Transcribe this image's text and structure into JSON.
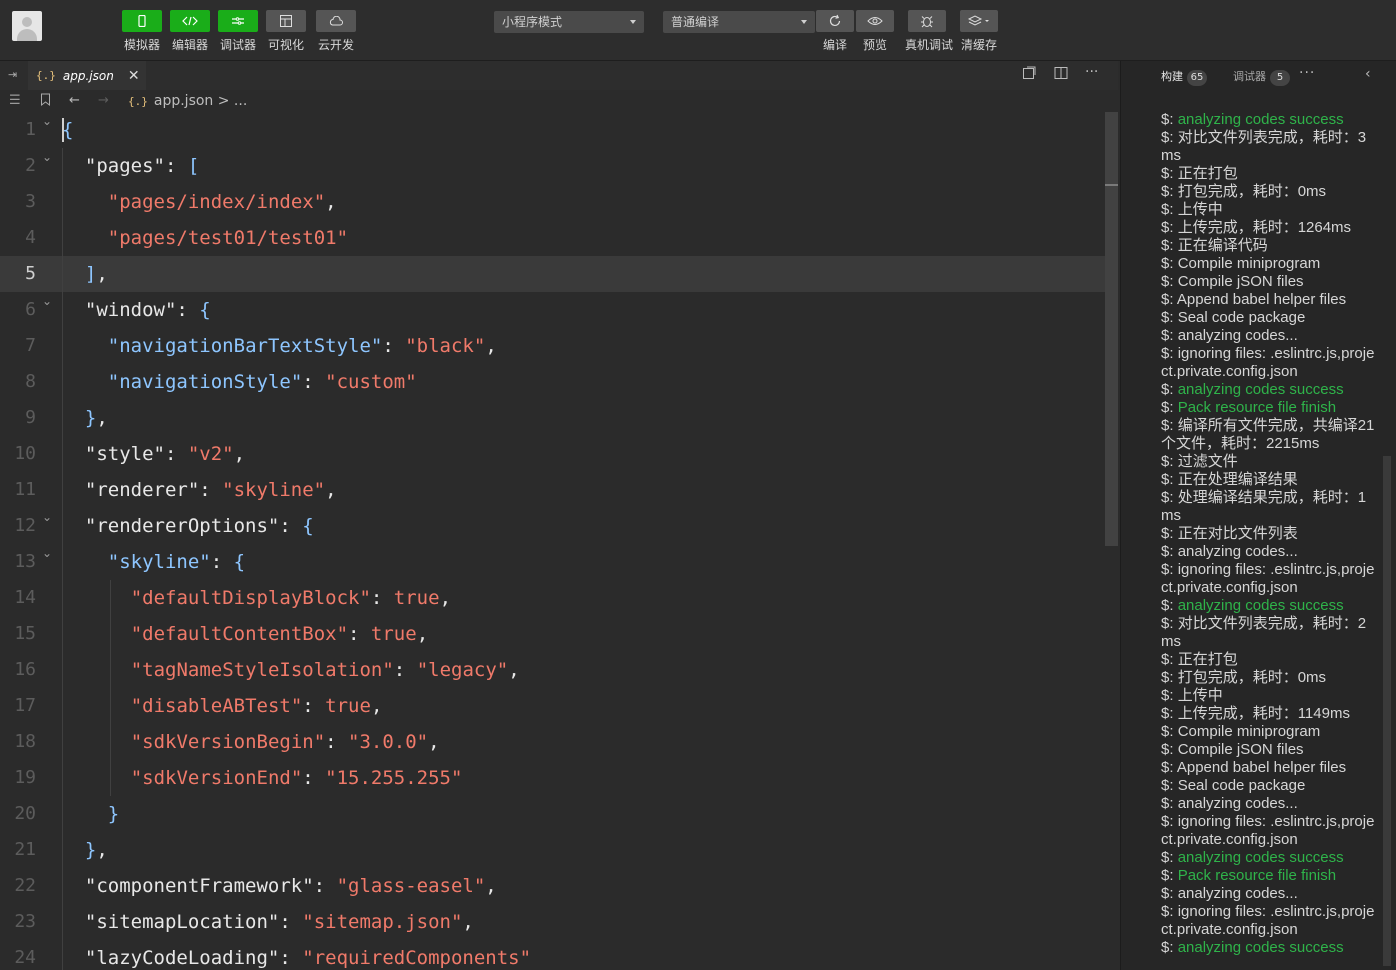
{
  "toolbar": {
    "left_buttons": [
      {
        "label": "模拟器",
        "icon": "phone-icon"
      },
      {
        "label": "编辑器",
        "icon": "code-icon"
      },
      {
        "label": "调试器",
        "icon": "debug-icon"
      },
      {
        "label": "可视化",
        "icon": "layout-icon"
      },
      {
        "label": "云开发",
        "icon": "cloud-icon"
      }
    ],
    "mode_select": "小程序模式",
    "compile_select": "普通编译",
    "right_buttons": [
      {
        "label": "编译",
        "icon": "refresh-icon"
      },
      {
        "label": "预览",
        "icon": "eye-icon"
      },
      {
        "label": "真机调试",
        "icon": "bug-icon"
      },
      {
        "label": "清缓存",
        "icon": "layers-icon"
      }
    ]
  },
  "editor": {
    "tab": {
      "name": "app.json",
      "close": "✕",
      "icon": "{.}"
    },
    "breadcrumb": "app.json > ...",
    "breadcrumb_icon": "{.}",
    "current_line": 5,
    "lines": [
      {
        "n": "1",
        "indent": 0,
        "tokens": [
          {
            "c": "p",
            "t": "{"
          }
        ]
      },
      {
        "n": "2",
        "indent": 1,
        "tokens": [
          {
            "c": "k",
            "t": "\"pages\""
          },
          {
            "c": "k",
            "t": ": "
          },
          {
            "c": "p",
            "t": "["
          }
        ]
      },
      {
        "n": "3",
        "indent": 2,
        "tokens": [
          {
            "c": "s",
            "t": "\"pages/index/index\""
          },
          {
            "c": "k",
            "t": ","
          }
        ]
      },
      {
        "n": "4",
        "indent": 2,
        "tokens": [
          {
            "c": "s",
            "t": "\"pages/test01/test01\""
          }
        ]
      },
      {
        "n": "5",
        "indent": 1,
        "tokens": [
          {
            "c": "p",
            "t": "]"
          },
          {
            "c": "k",
            "t": ","
          }
        ]
      },
      {
        "n": "6",
        "indent": 1,
        "tokens": [
          {
            "c": "k",
            "t": "\"window\""
          },
          {
            "c": "k",
            "t": ": "
          },
          {
            "c": "p",
            "t": "{"
          }
        ]
      },
      {
        "n": "7",
        "indent": 2,
        "tokens": [
          {
            "c": "p",
            "t": "\"navigationBarTextStyle\""
          },
          {
            "c": "k",
            "t": ": "
          },
          {
            "c": "s",
            "t": "\"black\""
          },
          {
            "c": "k",
            "t": ","
          }
        ]
      },
      {
        "n": "8",
        "indent": 2,
        "tokens": [
          {
            "c": "p",
            "t": "\"navigationStyle\""
          },
          {
            "c": "k",
            "t": ": "
          },
          {
            "c": "s",
            "t": "\"custom\""
          }
        ]
      },
      {
        "n": "9",
        "indent": 1,
        "tokens": [
          {
            "c": "p",
            "t": "}"
          },
          {
            "c": "k",
            "t": ","
          }
        ]
      },
      {
        "n": "10",
        "indent": 1,
        "tokens": [
          {
            "c": "k",
            "t": "\"style\""
          },
          {
            "c": "k",
            "t": ": "
          },
          {
            "c": "s",
            "t": "\"v2\""
          },
          {
            "c": "k",
            "t": ","
          }
        ]
      },
      {
        "n": "11",
        "indent": 1,
        "tokens": [
          {
            "c": "k",
            "t": "\"renderer\""
          },
          {
            "c": "k",
            "t": ": "
          },
          {
            "c": "s",
            "t": "\"skyline\""
          },
          {
            "c": "k",
            "t": ","
          }
        ]
      },
      {
        "n": "12",
        "indent": 1,
        "tokens": [
          {
            "c": "k",
            "t": "\"rendererOptions\""
          },
          {
            "c": "k",
            "t": ": "
          },
          {
            "c": "p",
            "t": "{"
          }
        ]
      },
      {
        "n": "13",
        "indent": 2,
        "tokens": [
          {
            "c": "p",
            "t": "\"skyline\""
          },
          {
            "c": "k",
            "t": ": "
          },
          {
            "c": "p",
            "t": "{"
          }
        ]
      },
      {
        "n": "14",
        "indent": 3,
        "tokens": [
          {
            "c": "s",
            "t": "\"defaultDisplayBlock\""
          },
          {
            "c": "k",
            "t": ": "
          },
          {
            "c": "t",
            "t": "true"
          },
          {
            "c": "k",
            "t": ","
          }
        ]
      },
      {
        "n": "15",
        "indent": 3,
        "tokens": [
          {
            "c": "s",
            "t": "\"defaultContentBox\""
          },
          {
            "c": "k",
            "t": ": "
          },
          {
            "c": "t",
            "t": "true"
          },
          {
            "c": "k",
            "t": ","
          }
        ]
      },
      {
        "n": "16",
        "indent": 3,
        "tokens": [
          {
            "c": "s",
            "t": "\"tagNameStyleIsolation\""
          },
          {
            "c": "k",
            "t": ": "
          },
          {
            "c": "s",
            "t": "\"legacy\""
          },
          {
            "c": "k",
            "t": ","
          }
        ]
      },
      {
        "n": "17",
        "indent": 3,
        "tokens": [
          {
            "c": "s",
            "t": "\"disableABTest\""
          },
          {
            "c": "k",
            "t": ": "
          },
          {
            "c": "t",
            "t": "true"
          },
          {
            "c": "k",
            "t": ","
          }
        ]
      },
      {
        "n": "18",
        "indent": 3,
        "tokens": [
          {
            "c": "s",
            "t": "\"sdkVersionBegin\""
          },
          {
            "c": "k",
            "t": ": "
          },
          {
            "c": "s",
            "t": "\"3.0.0\""
          },
          {
            "c": "k",
            "t": ","
          }
        ]
      },
      {
        "n": "19",
        "indent": 3,
        "tokens": [
          {
            "c": "s",
            "t": "\"sdkVersionEnd\""
          },
          {
            "c": "k",
            "t": ": "
          },
          {
            "c": "s",
            "t": "\"15.255.255\""
          }
        ]
      },
      {
        "n": "20",
        "indent": 2,
        "tokens": [
          {
            "c": "p",
            "t": "}"
          }
        ]
      },
      {
        "n": "21",
        "indent": 1,
        "tokens": [
          {
            "c": "p",
            "t": "}"
          },
          {
            "c": "k",
            "t": ","
          }
        ]
      },
      {
        "n": "22",
        "indent": 1,
        "tokens": [
          {
            "c": "k",
            "t": "\"componentFramework\""
          },
          {
            "c": "k",
            "t": ": "
          },
          {
            "c": "s",
            "t": "\"glass-easel\""
          },
          {
            "c": "k",
            "t": ","
          }
        ]
      },
      {
        "n": "23",
        "indent": 1,
        "tokens": [
          {
            "c": "k",
            "t": "\"sitemapLocation\""
          },
          {
            "c": "k",
            "t": ": "
          },
          {
            "c": "s",
            "t": "\"sitemap.json\""
          },
          {
            "c": "k",
            "t": ","
          }
        ]
      },
      {
        "n": "24",
        "indent": 1,
        "tokens": [
          {
            "c": "k",
            "t": "\"lazyCodeLoading\""
          },
          {
            "c": "k",
            "t": ": "
          },
          {
            "c": "s",
            "t": "\"requiredComponents\""
          }
        ]
      }
    ]
  },
  "panel": {
    "tabs": [
      {
        "label": "构建",
        "count": "65"
      },
      {
        "label": "调试器",
        "count": "5"
      }
    ],
    "more": "···",
    "collapse": "‹",
    "log": [
      {
        "prefix": "$: ",
        "text": "analyzing codes success",
        "green": true
      },
      {
        "prefix": "$: ",
        "text": "对比文件列表完成，耗时：3ms",
        "green": false
      },
      {
        "prefix": "$: ",
        "text": "正在打包",
        "green": false
      },
      {
        "prefix": "$: ",
        "text": "打包完成，耗时：0ms",
        "green": false
      },
      {
        "prefix": "$: ",
        "text": "上传中",
        "green": false
      },
      {
        "prefix": "$: ",
        "text": "上传完成，耗时：1264ms",
        "green": false
      },
      {
        "prefix": "$: ",
        "text": "正在编译代码",
        "green": false
      },
      {
        "prefix": "$: ",
        "text": "Compile miniprogram",
        "green": false
      },
      {
        "prefix": "$: ",
        "text": "Compile jSON files",
        "green": false
      },
      {
        "prefix": "$: ",
        "text": "Append babel helper files",
        "green": false
      },
      {
        "prefix": "$: ",
        "text": "Seal code package",
        "green": false
      },
      {
        "prefix": "$: ",
        "text": "analyzing codes...",
        "green": false
      },
      {
        "prefix": "$: ",
        "text": "ignoring files: .eslintrc.js,project.private.config.json",
        "green": false
      },
      {
        "prefix": "$: ",
        "text": "analyzing codes success",
        "green": true
      },
      {
        "prefix": "$: ",
        "text": "Pack resource file finish",
        "green": true
      },
      {
        "prefix": "$: ",
        "text": "编译所有文件完成，共编译21 个文件，耗时：2215ms",
        "green": false
      },
      {
        "prefix": "$: ",
        "text": "过滤文件",
        "green": false
      },
      {
        "prefix": "$: ",
        "text": "正在处理编译结果",
        "green": false
      },
      {
        "prefix": "$: ",
        "text": "处理编译结果完成，耗时：1ms",
        "green": false
      },
      {
        "prefix": "$: ",
        "text": "正在对比文件列表",
        "green": false
      },
      {
        "prefix": "$: ",
        "text": "analyzing codes...",
        "green": false
      },
      {
        "prefix": "$: ",
        "text": "ignoring files: .eslintrc.js,project.private.config.json",
        "green": false
      },
      {
        "prefix": "$: ",
        "text": "analyzing codes success",
        "green": true
      },
      {
        "prefix": "$: ",
        "text": "对比文件列表完成，耗时：2ms",
        "green": false
      },
      {
        "prefix": "$: ",
        "text": "正在打包",
        "green": false
      },
      {
        "prefix": "$: ",
        "text": "打包完成，耗时：0ms",
        "green": false
      },
      {
        "prefix": "$: ",
        "text": "上传中",
        "green": false
      },
      {
        "prefix": "$: ",
        "text": "上传完成，耗时：1149ms",
        "green": false
      },
      {
        "prefix": "$: ",
        "text": "Compile miniprogram",
        "green": false
      },
      {
        "prefix": "$: ",
        "text": "Compile jSON files",
        "green": false
      },
      {
        "prefix": "$: ",
        "text": "Append babel helper files",
        "green": false
      },
      {
        "prefix": "$: ",
        "text": "Seal code package",
        "green": false
      },
      {
        "prefix": "$: ",
        "text": "analyzing codes...",
        "green": false
      },
      {
        "prefix": "$: ",
        "text": "ignoring files: .eslintrc.js,project.private.config.json",
        "green": false
      },
      {
        "prefix": "$: ",
        "text": "analyzing codes success",
        "green": true
      },
      {
        "prefix": "$: ",
        "text": "Pack resource file finish",
        "green": true
      },
      {
        "prefix": "$: ",
        "text": "analyzing codes...",
        "green": false
      },
      {
        "prefix": "$: ",
        "text": "ignoring files: .eslintrc.js,project.private.config.json",
        "green": false
      },
      {
        "prefix": "$: ",
        "text": "analyzing codes success",
        "green": true
      }
    ]
  },
  "colors": {
    "accent_green": "#1aad19",
    "log_green": "#2fb34a",
    "string": "#f07a6a",
    "punct": "#8ec6ff"
  }
}
